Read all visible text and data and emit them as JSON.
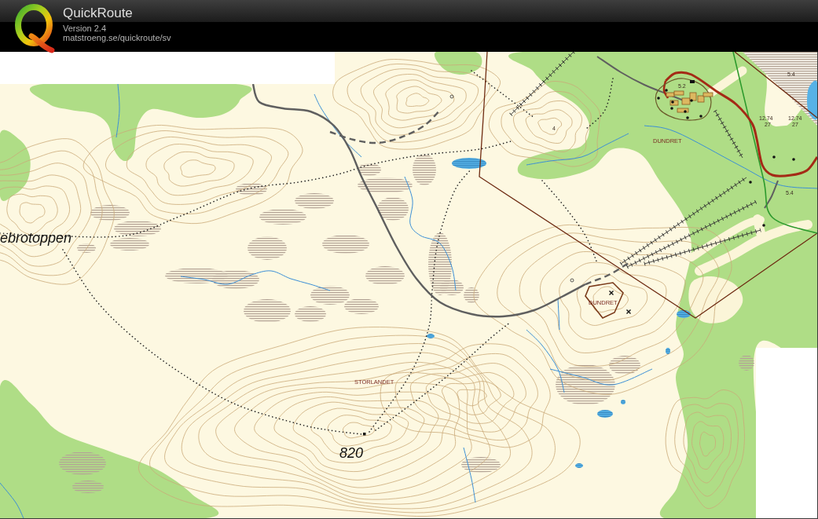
{
  "header": {
    "title": "QuickRoute",
    "version": "Version 2.4",
    "url": "matstroeng.se/quickroute/sv"
  },
  "map": {
    "labels": [
      {
        "text": "ebrotoppen",
        "kind": "place"
      },
      {
        "text": "820",
        "kind": "height"
      },
      {
        "text": "STORLANDET",
        "kind": "feature"
      },
      {
        "text": "DUNDRET",
        "kind": "feature"
      },
      {
        "text": "DUNDRET",
        "kind": "feature"
      },
      {
        "text": "4",
        "kind": "spot"
      },
      {
        "text": "5.4",
        "kind": "spot"
      },
      {
        "text": "5.2",
        "kind": "spot"
      },
      {
        "text": "12.74",
        "kind": "spot"
      },
      {
        "text": "27",
        "kind": "spot"
      },
      {
        "text": "12.74",
        "kind": "spot"
      },
      {
        "text": "27",
        "kind": "spot"
      },
      {
        "text": "5.4",
        "kind": "spot"
      }
    ]
  }
}
